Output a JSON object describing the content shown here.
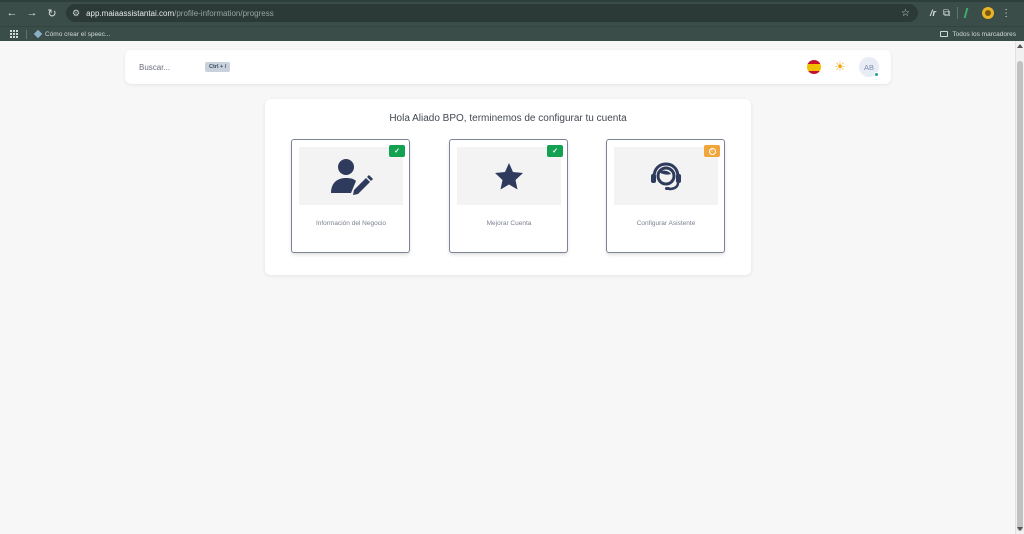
{
  "browser": {
    "url_host": "app.maiaassistantai.com",
    "url_path": "/profile-information/progress",
    "bookmark": "Cómo crear el speec...",
    "bookmarks_folder": "Todos los marcadores",
    "ext_ai_label": "/r"
  },
  "header": {
    "search_placeholder": "Buscar...",
    "shortcut": "Ctrl + /",
    "avatar_initials": "AB",
    "language": "es"
  },
  "main": {
    "title": "Hola Aliado BPO, terminemos de configurar tu cuenta",
    "steps": [
      {
        "label": "Información del Negocio",
        "icon": "user-edit-icon",
        "status": "completed"
      },
      {
        "label": "Mejorar Cuenta",
        "icon": "star-icon",
        "status": "completed"
      },
      {
        "label": "Configurar Asistente",
        "icon": "headset-icon",
        "status": "pending"
      }
    ]
  },
  "colors": {
    "completed": "#12a150",
    "pending": "#f1a53a",
    "icon": "#2f3b5c"
  }
}
